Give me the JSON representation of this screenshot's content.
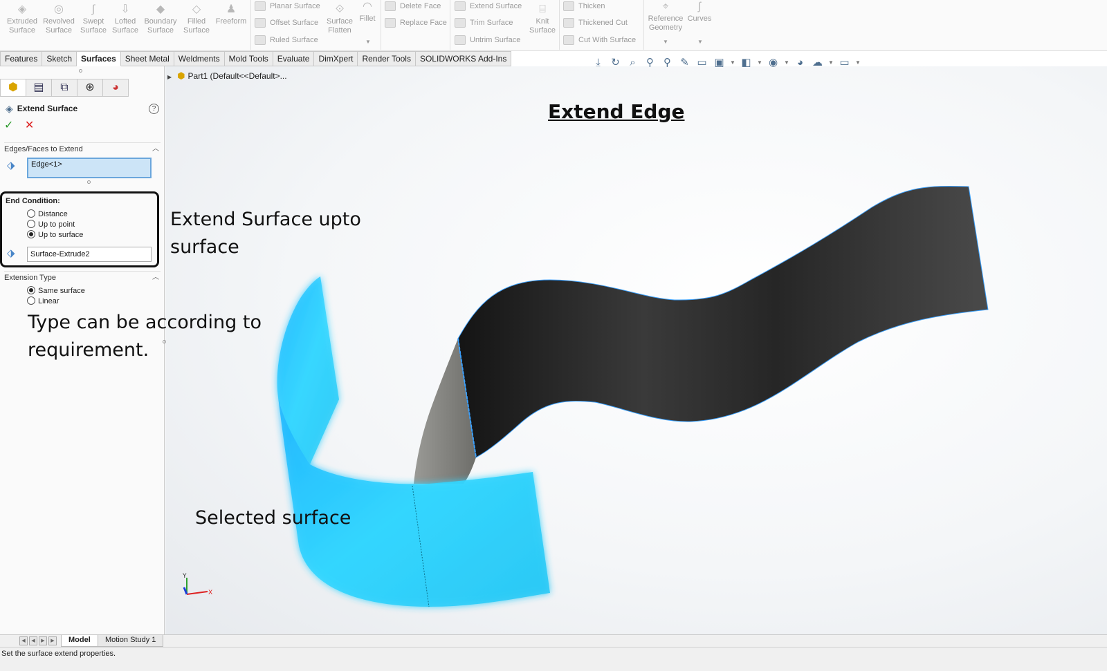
{
  "ribbon": {
    "big_buttons": [
      {
        "label": "Extruded\nSurface",
        "icon": "extruded-surface-icon"
      },
      {
        "label": "Revolved\nSurface",
        "icon": "revolved-surface-icon"
      },
      {
        "label": "Swept\nSurface",
        "icon": "swept-surface-icon"
      },
      {
        "label": "Lofted\nSurface",
        "icon": "lofted-surface-icon"
      },
      {
        "label": "Boundary\nSurface",
        "icon": "boundary-surface-icon"
      },
      {
        "label": "Filled\nSurface",
        "icon": "filled-surface-icon"
      },
      {
        "label": "Freeform",
        "icon": "freeform-icon"
      }
    ],
    "group1": [
      "Planar Surface",
      "Offset Surface",
      "Ruled Surface"
    ],
    "surface_flatten": "Surface\nFlatten",
    "fillet": "Fillet",
    "group2": [
      "Delete Face",
      "Replace Face"
    ],
    "group3": [
      "Extend Surface",
      "Trim Surface",
      "Untrim Surface"
    ],
    "knit_surface": "Knit\nSurface",
    "group4": [
      "Thicken",
      "Thickened Cut",
      "Cut With Surface"
    ],
    "reference_geometry": "Reference\nGeometry",
    "curves": "Curves"
  },
  "tabs": [
    "Features",
    "Sketch",
    "Surfaces",
    "Sheet Metal",
    "Weldments",
    "Mold Tools",
    "Evaluate",
    "DimXpert",
    "Render Tools",
    "SOLIDWORKS Add-Ins"
  ],
  "active_tab": "Surfaces",
  "tree": {
    "part_label": "Part1  (Default<<Default>..."
  },
  "property_manager": {
    "title": "Extend Surface",
    "help": "?",
    "ok": "✓",
    "cancel": "✕",
    "edges_section": "Edges/Faces to Extend",
    "edges_value": "Edge<1>",
    "end_condition_label": "End Condition:",
    "end_conditions": [
      {
        "label": "Distance",
        "checked": false
      },
      {
        "label": "Up to point",
        "checked": false
      },
      {
        "label": "Up to surface",
        "checked": true
      }
    ],
    "end_surface_value": "Surface-Extrude2",
    "extension_type_section": "Extension Type",
    "extension_types": [
      {
        "label": "Same surface",
        "checked": true
      },
      {
        "label": "Linear",
        "checked": false
      }
    ]
  },
  "annotations": {
    "title": "Extend Edge",
    "extend_line1": "Extend Surface upto",
    "extend_line2": "surface",
    "type_line1": "Type can be according to",
    "type_line2": "requirement.",
    "selected": "Selected surface"
  },
  "triad": {
    "x": "X",
    "y": "Y"
  },
  "bottom_tabs": [
    "Model",
    "Motion Study 1"
  ],
  "status": "Set the surface extend properties.",
  "colors": {
    "cyan_surface": "#33d6ff",
    "dark_surface": "#2e2e2e",
    "grey_extension": "#8a8a8a",
    "edge_blue": "#3aa0ff"
  }
}
